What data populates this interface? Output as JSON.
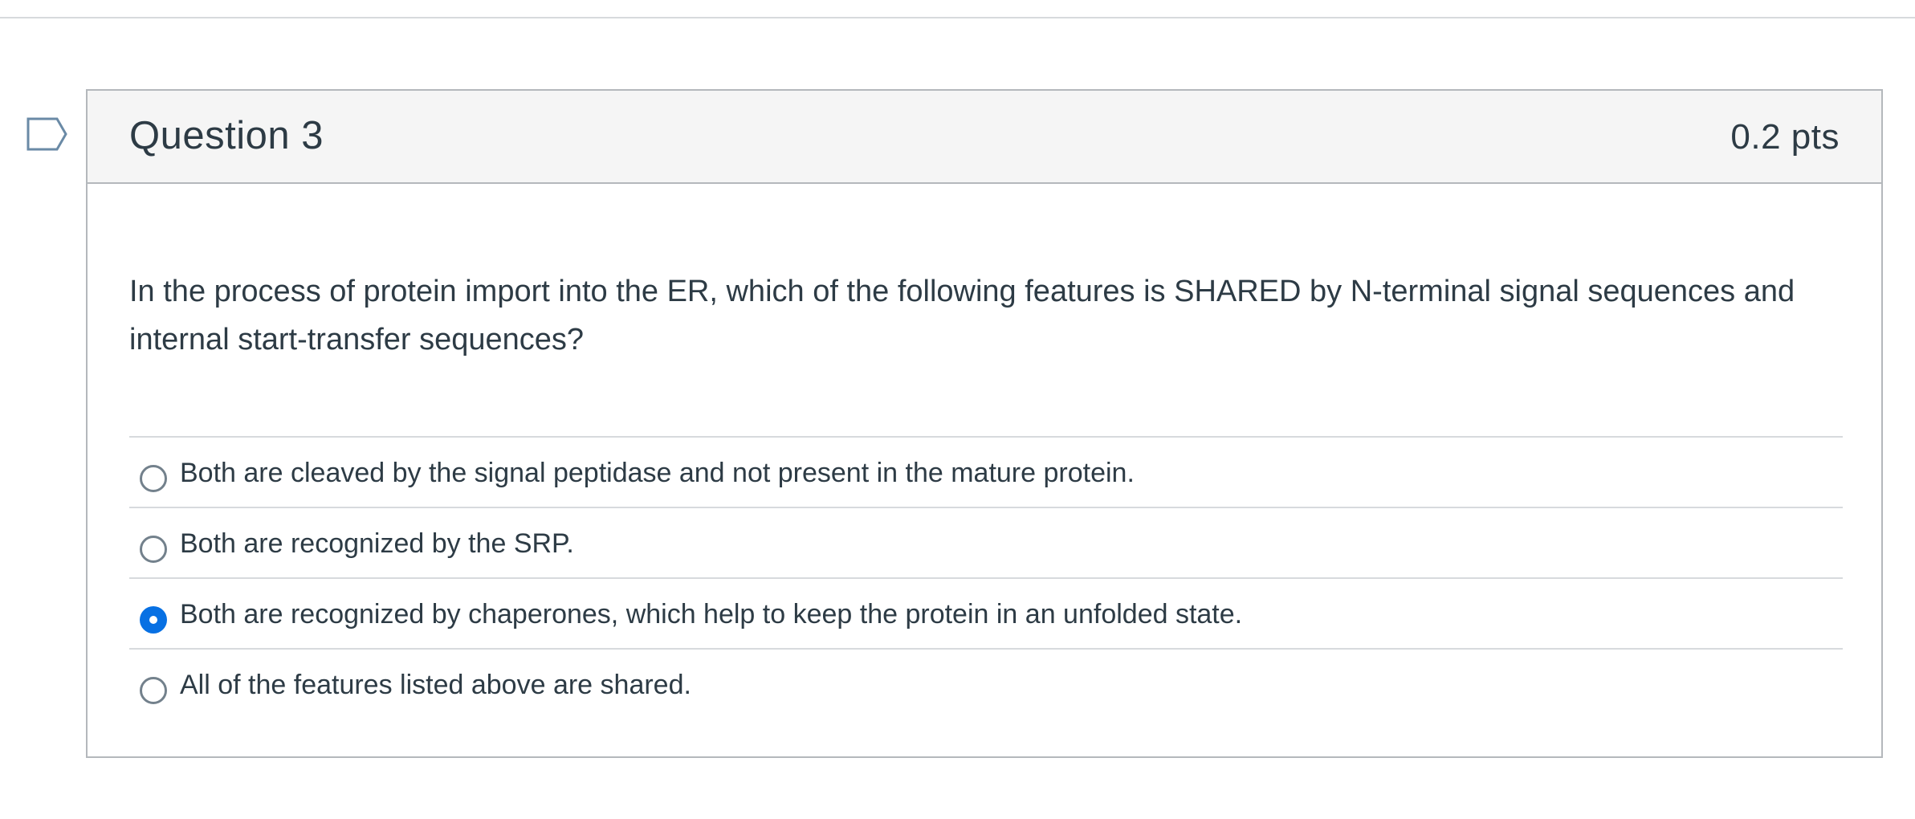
{
  "question": {
    "title": "Question 3",
    "points": "0.2 pts",
    "text": "In the process of protein import into the ER, which of the following features is SHARED by N-terminal signal sequences and internal start-transfer sequences?",
    "flag_icon": "bookmark-flag-icon"
  },
  "answers": [
    {
      "label": "Both are cleaved by the signal peptidase and not present in the mature protein.",
      "selected": false
    },
    {
      "label": "Both are recognized by the SRP.",
      "selected": false
    },
    {
      "label": "Both are recognized by chaperones, which help to keep the protein in an unfolded state.",
      "selected": true
    },
    {
      "label": "All of the features listed above are shared.",
      "selected": false
    }
  ],
  "colors": {
    "accent": "#0770e3",
    "text": "#2d3b45",
    "header_bg": "#f5f5f5",
    "border": "#b4b8bc",
    "flag": "#6a8aa6"
  }
}
